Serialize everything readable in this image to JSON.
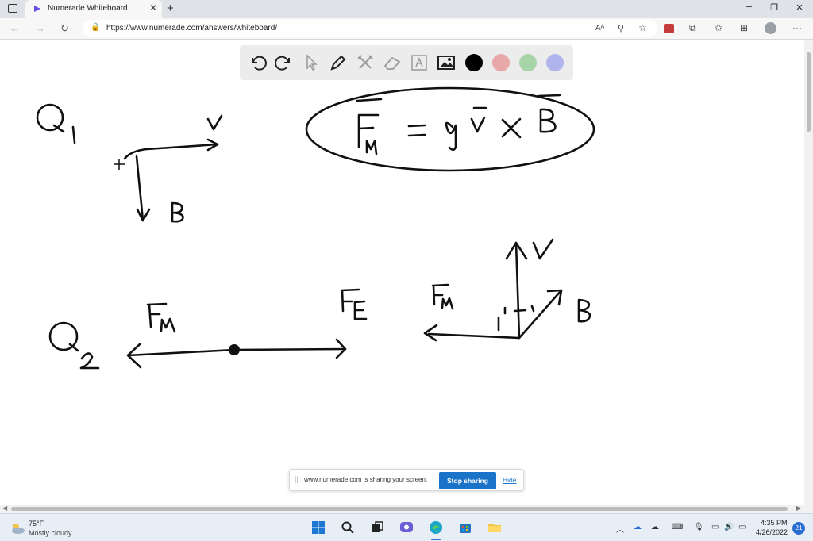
{
  "browser": {
    "tab_title": "Numerade Whiteboard",
    "tab_close": "✕",
    "new_tab": "+",
    "url": "https://www.numerade.com/answers/whiteboard/",
    "window_controls": [
      "─",
      "❐",
      "✕"
    ]
  },
  "whiteboard": {
    "tools": [
      "undo-icon",
      "redo-icon",
      "pointer-icon",
      "pen-icon",
      "tools-icon",
      "eraser-icon",
      "text-box-icon",
      "image-icon"
    ],
    "colors": [
      "#000000",
      "#e8a8a8",
      "#a8d4a8",
      "#b0b4ec"
    ],
    "drawing": {
      "q1_label": "Q",
      "q1_sub": "1",
      "q1_v_label": "v",
      "q1_b_label": "B",
      "formula": "F̅m = q v̅ × B̅",
      "q2_label": "Q",
      "q2_sub": "2",
      "fm_left": "Fm",
      "fe_label": "FE",
      "fm_right": "Fm",
      "v_label": "v",
      "b_label": "B"
    }
  },
  "share_banner": {
    "message": "www.numerade.com is sharing your screen.",
    "stop_button": "Stop sharing",
    "hide_link": "Hide"
  },
  "taskbar": {
    "weather_temp": "75°F",
    "weather_desc": "Mostly cloudy",
    "time": "4:35 PM",
    "date": "4/26/2022",
    "notification_count": "21"
  }
}
